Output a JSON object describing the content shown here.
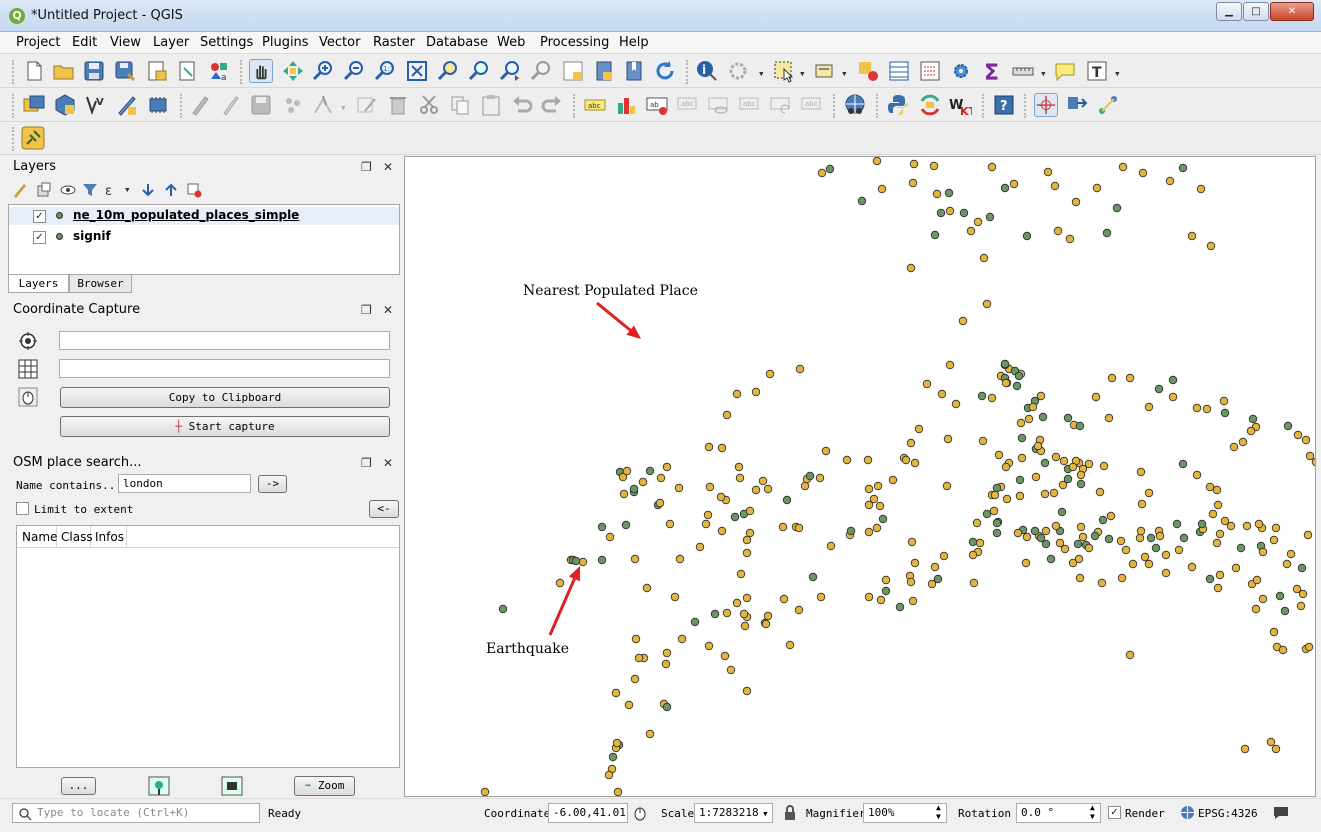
{
  "window": {
    "title": "*Untitled Project - QGIS",
    "minimize": "▁",
    "maximize": "□",
    "close": "✕"
  },
  "menu": [
    "Project",
    "Edit",
    "View",
    "Layer",
    "Settings",
    "Plugins",
    "Vector",
    "Raster",
    "Database",
    "Web",
    "Processing",
    "Help"
  ],
  "layers_panel": {
    "title": "Layers",
    "layers": [
      {
        "name": "ne_10m_populated_places_simple",
        "checked": true
      },
      {
        "name": "signif",
        "checked": true
      }
    ],
    "tabs": [
      "Layers",
      "Browser"
    ]
  },
  "coordinate_capture": {
    "title": "Coordinate Capture",
    "field1": "",
    "field2": "",
    "copy_label": "Copy to Clipboard",
    "capture_label": "Start capture"
  },
  "osm_search": {
    "title": "OSM place search...",
    "name_label": "Name contains...",
    "name_value": "london",
    "go_label": "->",
    "limit_label": "Limit to extent",
    "back_label": "<-",
    "columns": [
      "Name",
      "Class",
      "Infos"
    ],
    "more_label": "...",
    "zoom_label": "Zoom"
  },
  "map": {
    "annotations": {
      "place": "Nearest Populated Place",
      "quake": "Earthquake"
    },
    "colors": {
      "place": "#e3b53e",
      "quake": "#6a9664",
      "arrow": "#e02020"
    }
  },
  "statusbar": {
    "locate_placeholder": "Type to locate (Ctrl+K)",
    "ready": "Ready",
    "coord_label": "Coordinate",
    "coord_value": "-6.00,41.01",
    "scale_label": "Scale",
    "scale_value": "1:7283218",
    "magnifier_label": "Magnifier",
    "magnifier_value": "100%",
    "rotation_label": "Rotation",
    "rotation_value": "0.0 °",
    "render_label": "Render",
    "epsg": "EPSG:4326"
  }
}
